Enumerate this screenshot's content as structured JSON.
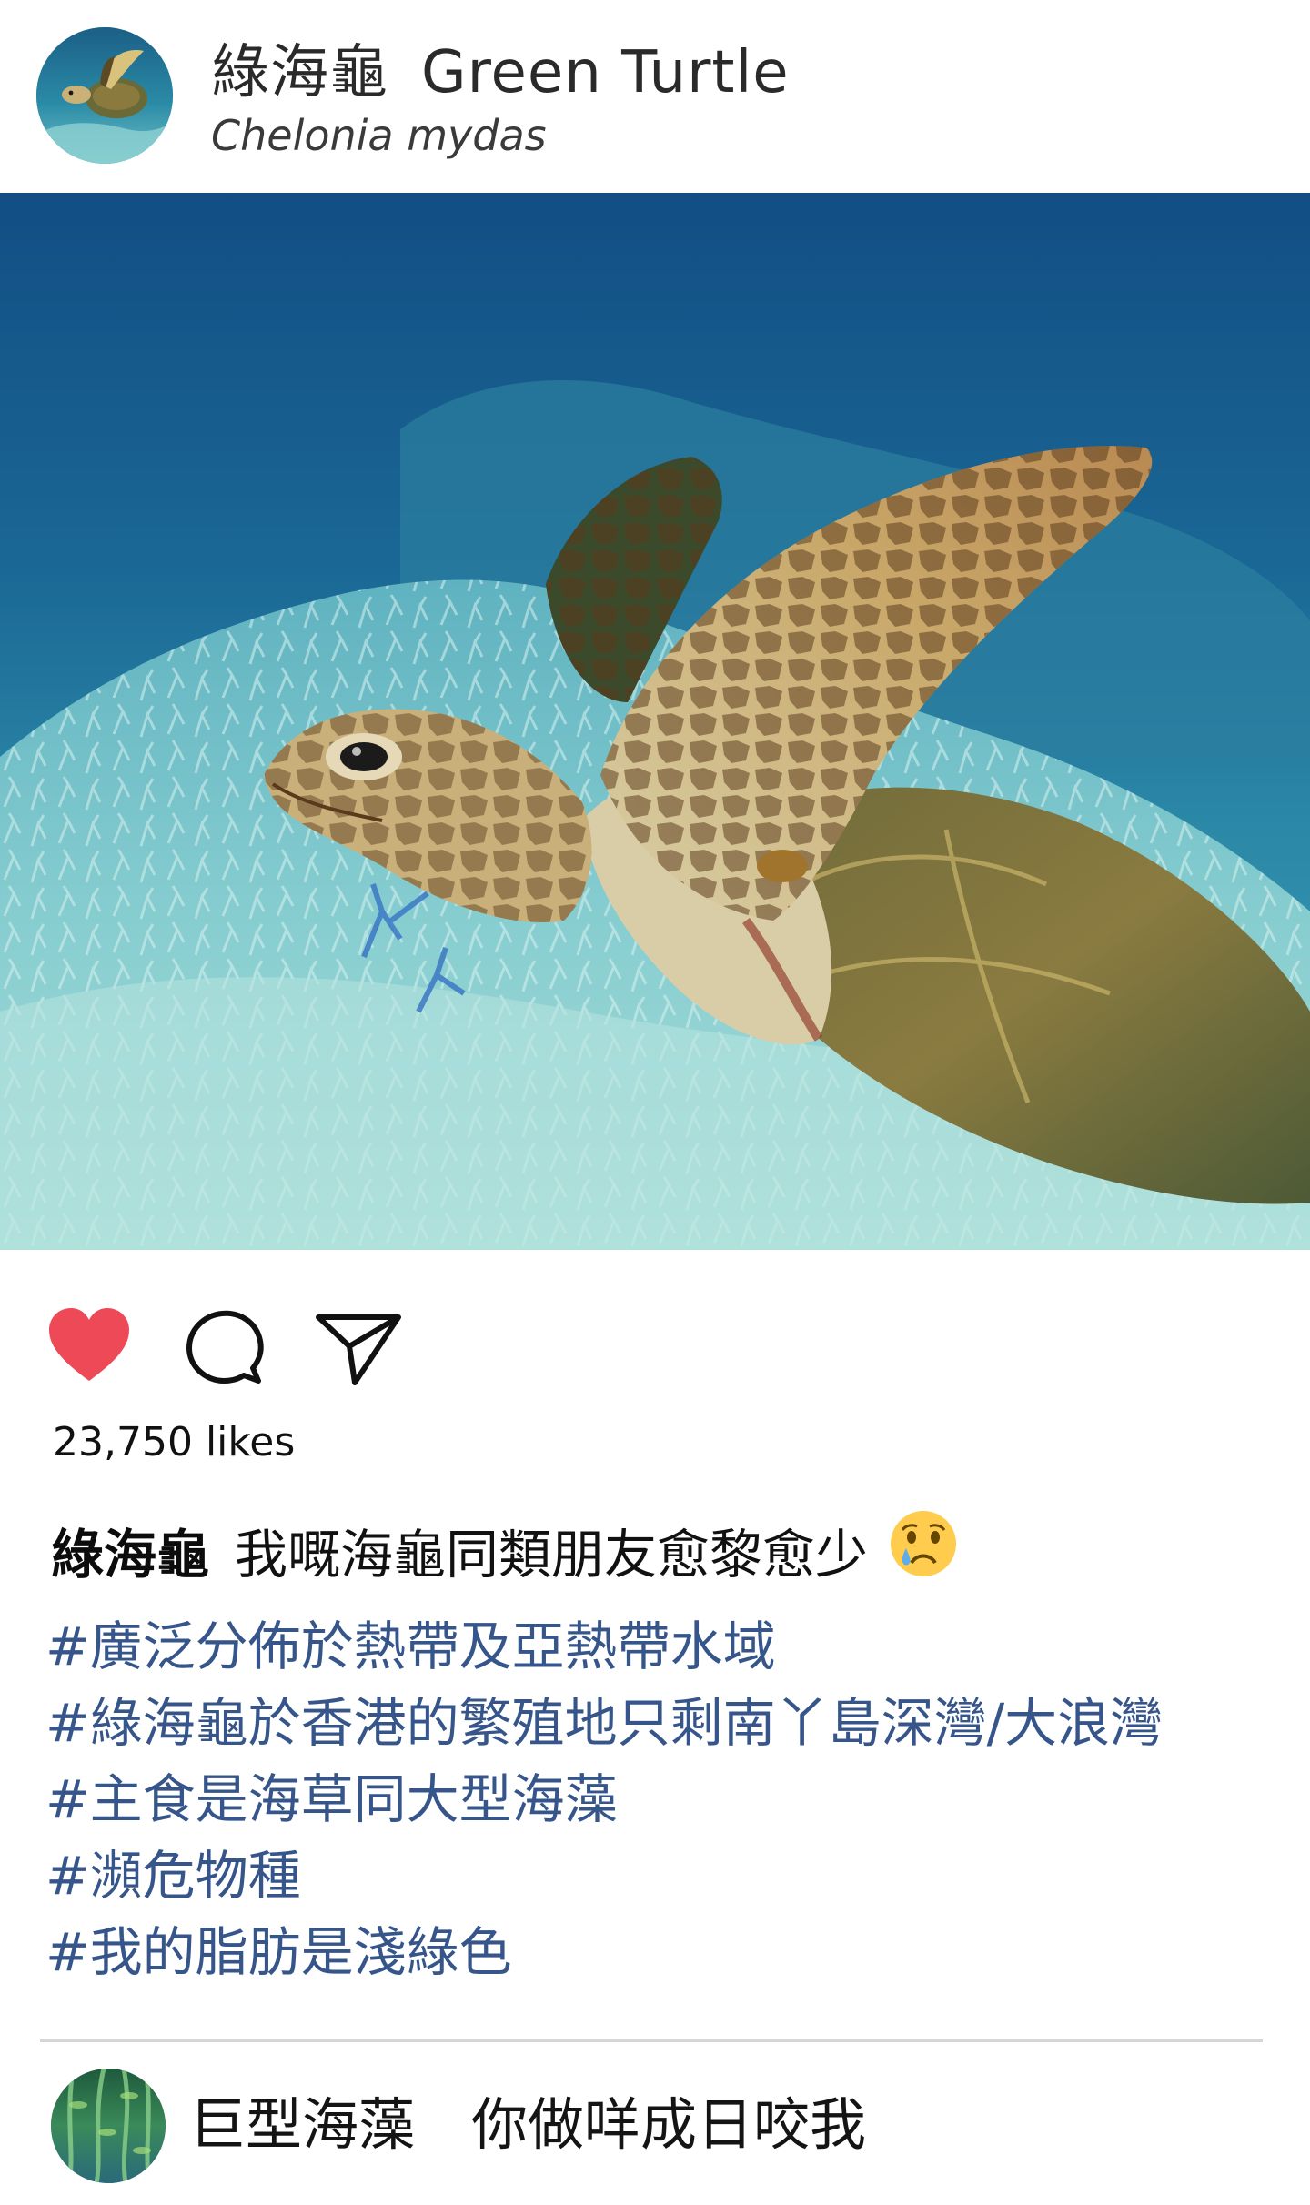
{
  "post": {
    "profile_name_zh": "綠海龜",
    "profile_name_en": "Green Turtle",
    "profile_subtitle": "Chelonia mydas",
    "image_subject": "green sea turtle swimming over bleached coral reef",
    "likes_text": "23,750 likes",
    "liked": true,
    "caption": {
      "author": "綠海龜",
      "text": "我嘅海龜同類朋友愈黎愈少",
      "emoji": "crying-face"
    },
    "hashtags": [
      "#廣泛分佈於熱帶及亞熱帶水域",
      "#綠海龜於香港的繁殖地只剩南丫島深灣/大浪灣",
      "#主食是海草同大型海藻",
      "#瀕危物種",
      "#我的脂肪是淺綠色"
    ]
  },
  "comment": {
    "author": "巨型海藻",
    "text": "你做咩成日咬我"
  },
  "icons": {
    "like": "heart-icon",
    "comment": "speech-bubble-icon",
    "share": "paper-plane-icon"
  },
  "colors": {
    "like_red": "#ed4956",
    "hashtag_blue": "#36558a",
    "ocean_blue": "#1a5e8a",
    "coral": "#7fc9cf"
  }
}
